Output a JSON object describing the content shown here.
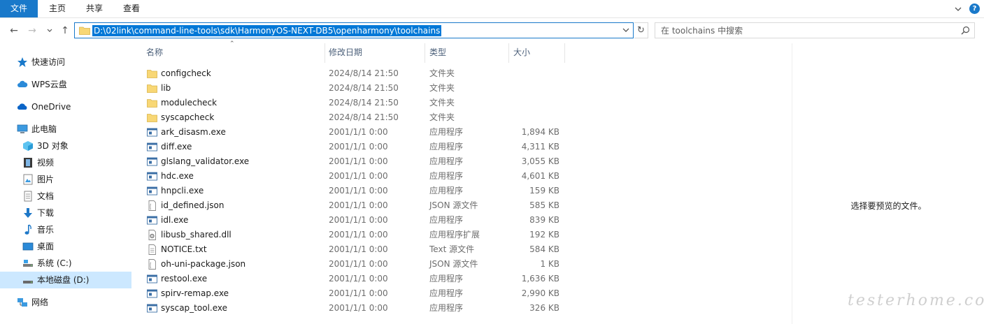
{
  "ribbon": {
    "tabs": [
      {
        "label": "文件"
      },
      {
        "label": "主页"
      },
      {
        "label": "共享"
      },
      {
        "label": "查看"
      }
    ],
    "accent_color": "#1979ca"
  },
  "address_bar": {
    "path": "D:\\02link\\command-line-tools\\sdk\\HarmonyOS-NEXT-DB5\\openharmony\\toolchains"
  },
  "search": {
    "placeholder": "在 toolchains 中搜索"
  },
  "sidebar": {
    "items": [
      {
        "label": "快速访问",
        "icon": "star-icon"
      },
      {
        "label": "WPS云盘",
        "icon": "cloud-icon"
      },
      {
        "label": "OneDrive",
        "icon": "onedrive-icon"
      },
      {
        "label": "此电脑",
        "icon": "computer-icon"
      },
      {
        "label": "3D 对象",
        "icon": "cube-icon"
      },
      {
        "label": "视频",
        "icon": "film-icon"
      },
      {
        "label": "图片",
        "icon": "picture-icon"
      },
      {
        "label": "文档",
        "icon": "document-icon"
      },
      {
        "label": "下载",
        "icon": "download-icon"
      },
      {
        "label": "音乐",
        "icon": "music-icon"
      },
      {
        "label": "桌面",
        "icon": "desktop-icon"
      },
      {
        "label": "系统 (C:)",
        "icon": "drive-icon"
      },
      {
        "label": "本地磁盘 (D:)",
        "icon": "drive-icon",
        "selected": true
      },
      {
        "label": "网络",
        "icon": "network-icon"
      }
    ]
  },
  "columns": {
    "name": "名称",
    "date": "修改日期",
    "type": "类型",
    "size": "大小"
  },
  "files": [
    {
      "name": "configcheck",
      "date": "2024/8/14 21:50",
      "type": "文件夹",
      "size": "",
      "icon": "folder-icon"
    },
    {
      "name": "lib",
      "date": "2024/8/14 21:50",
      "type": "文件夹",
      "size": "",
      "icon": "folder-icon"
    },
    {
      "name": "modulecheck",
      "date": "2024/8/14 21:50",
      "type": "文件夹",
      "size": "",
      "icon": "folder-icon"
    },
    {
      "name": "syscapcheck",
      "date": "2024/8/14 21:50",
      "type": "文件夹",
      "size": "",
      "icon": "folder-icon"
    },
    {
      "name": "ark_disasm.exe",
      "date": "2001/1/1 0:00",
      "type": "应用程序",
      "size": "1,894 KB",
      "icon": "exe-icon"
    },
    {
      "name": "diff.exe",
      "date": "2001/1/1 0:00",
      "type": "应用程序",
      "size": "4,311 KB",
      "icon": "exe-icon"
    },
    {
      "name": "glslang_validator.exe",
      "date": "2001/1/1 0:00",
      "type": "应用程序",
      "size": "3,055 KB",
      "icon": "exe-icon"
    },
    {
      "name": "hdc.exe",
      "date": "2001/1/1 0:00",
      "type": "应用程序",
      "size": "4,601 KB",
      "icon": "exe-icon"
    },
    {
      "name": "hnpcli.exe",
      "date": "2001/1/1 0:00",
      "type": "应用程序",
      "size": "159 KB",
      "icon": "exe-icon"
    },
    {
      "name": "id_defined.json",
      "date": "2001/1/1 0:00",
      "type": "JSON 源文件",
      "size": "585 KB",
      "icon": "json-file-icon"
    },
    {
      "name": "idl.exe",
      "date": "2001/1/1 0:00",
      "type": "应用程序",
      "size": "839 KB",
      "icon": "exe-icon"
    },
    {
      "name": "libusb_shared.dll",
      "date": "2001/1/1 0:00",
      "type": "应用程序扩展",
      "size": "192 KB",
      "icon": "dll-icon"
    },
    {
      "name": "NOTICE.txt",
      "date": "2001/1/1 0:00",
      "type": "Text 源文件",
      "size": "584 KB",
      "icon": "text-file-icon"
    },
    {
      "name": "oh-uni-package.json",
      "date": "2001/1/1 0:00",
      "type": "JSON 源文件",
      "size": "1 KB",
      "icon": "json-file-icon"
    },
    {
      "name": "restool.exe",
      "date": "2001/1/1 0:00",
      "type": "应用程序",
      "size": "1,636 KB",
      "icon": "exe-icon"
    },
    {
      "name": "spirv-remap.exe",
      "date": "2001/1/1 0:00",
      "type": "应用程序",
      "size": "2,990 KB",
      "icon": "exe-icon"
    },
    {
      "name": "syscap_tool.exe",
      "date": "2001/1/1 0:00",
      "type": "应用程序",
      "size": "326 KB",
      "icon": "exe-icon"
    }
  ],
  "preview": {
    "message": "选择要预览的文件。"
  },
  "watermark": "testerhome.com",
  "colors": {
    "selection_blue": "#0078d7",
    "folder_yellow": "#f8d775",
    "selected_nav": "#cce8ff"
  }
}
